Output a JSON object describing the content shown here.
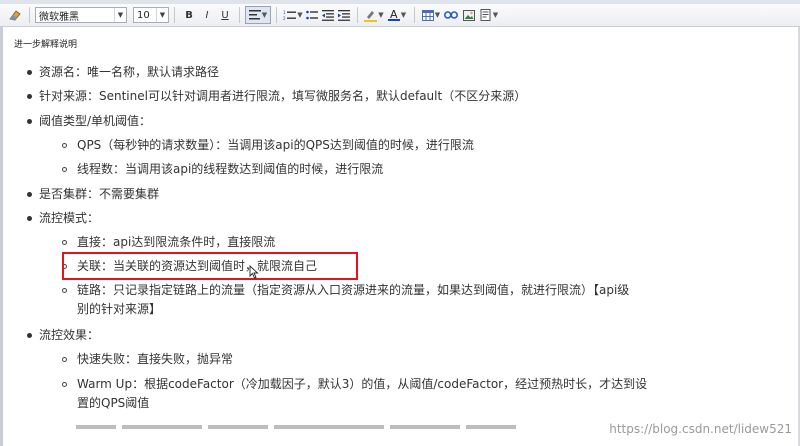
{
  "toolbar": {
    "font_name": "微软雅黑",
    "font_size": "10",
    "bold_label": "B",
    "italic_label": "I",
    "underline_label": "U",
    "text_color_letter": "A",
    "icons": [
      "eraser-icon",
      "align-icon",
      "ordered-list-icon",
      "unordered-list-icon",
      "outdent-icon",
      "indent-icon",
      "highlight-icon",
      "font-color-icon",
      "table-icon",
      "link-icon",
      "image-icon",
      "insert-icon"
    ]
  },
  "colors": {
    "highlight_bar": "#e8c81a",
    "font_color_bar": "#1a3fbf",
    "annotation_box": "#e3141b",
    "watermark": "#9a9a9a"
  },
  "editor": {
    "heading": "进一步解释说明",
    "items": [
      {
        "text": "资源名：唯一名称，默认请求路径"
      },
      {
        "text": "针对来源：Sentinel可以针对调用者进行限流，填写微服务名，默认default（不区分来源）"
      },
      {
        "text": "阈值类型/单机阈值："
      },
      {
        "text": "QPS（每秒钟的请求数量）：当调用该api的QPS达到阈值的时候，进行限流"
      },
      {
        "text": "线程数：当调用该api的线程数达到阈值的时候，进行限流"
      },
      {
        "text": "是否集群：不需要集群"
      },
      {
        "text": "流控模式："
      },
      {
        "text": "直接：api达到限流条件时，直接限流"
      },
      {
        "text": "关联：当关联的资源达到阈值时，就限流自己"
      },
      {
        "text": "链路：只记录指定链路上的流量（指定资源从入口资源进来的流量，如果达到阈值，就进行限流）【api级"
      },
      {
        "text": "别的针对来源】"
      },
      {
        "text": "流控效果："
      },
      {
        "text": "快速失败：直接失败，抛异常"
      },
      {
        "text": "Warm Up：根据codeFactor（冷加载因子，默认3）的值，从阈值/codeFactor，经过预热时长，才达到设"
      },
      {
        "text": "置的QPS阈值"
      }
    ]
  },
  "watermark": "https://blog.csdn.net/lidew521"
}
